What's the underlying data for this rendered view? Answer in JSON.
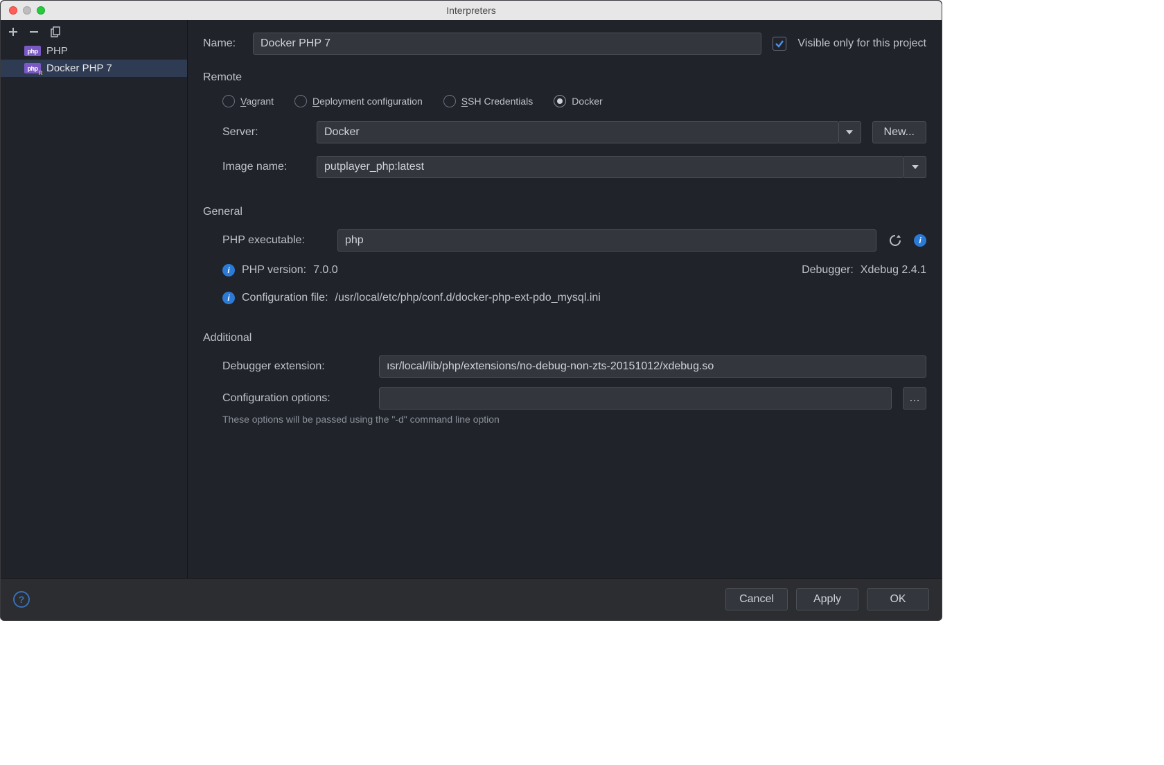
{
  "window": {
    "title": "Interpreters"
  },
  "sidebar": {
    "items": [
      {
        "label": "PHP",
        "remote": false
      },
      {
        "label": "Docker PHP 7",
        "remote": true
      }
    ]
  },
  "name": {
    "label": "Name:",
    "value": "Docker PHP 7"
  },
  "visible_checkbox": {
    "label": "Visible only for this project",
    "checked": true
  },
  "remote": {
    "title": "Remote",
    "options": {
      "vagrant": "Vagrant",
      "deployment": "Deployment configuration",
      "ssh": "SSH Credentials",
      "docker": "Docker"
    },
    "server_label": "Server:",
    "server_value": "Docker",
    "new_button": "New...",
    "image_label": "Image name:",
    "image_value": "putplayer_php:latest"
  },
  "general": {
    "title": "General",
    "exe_label": "PHP executable:",
    "exe_value": "php",
    "version_label": "PHP version:",
    "version_value": "7.0.0",
    "debugger_label": "Debugger:",
    "debugger_value": "Xdebug 2.4.1",
    "config_label": "Configuration file:",
    "config_value": "/usr/local/etc/php/conf.d/docker-php-ext-pdo_mysql.ini"
  },
  "additional": {
    "title": "Additional",
    "ext_label": "Debugger extension:",
    "ext_value": "ısr/local/lib/php/extensions/no-debug-non-zts-20151012/xdebug.so",
    "opts_label": "Configuration options:",
    "opts_value": "",
    "hint": "These options will be passed using the \"-d\" command line option"
  },
  "footer": {
    "cancel": "Cancel",
    "apply": "Apply",
    "ok": "OK"
  }
}
